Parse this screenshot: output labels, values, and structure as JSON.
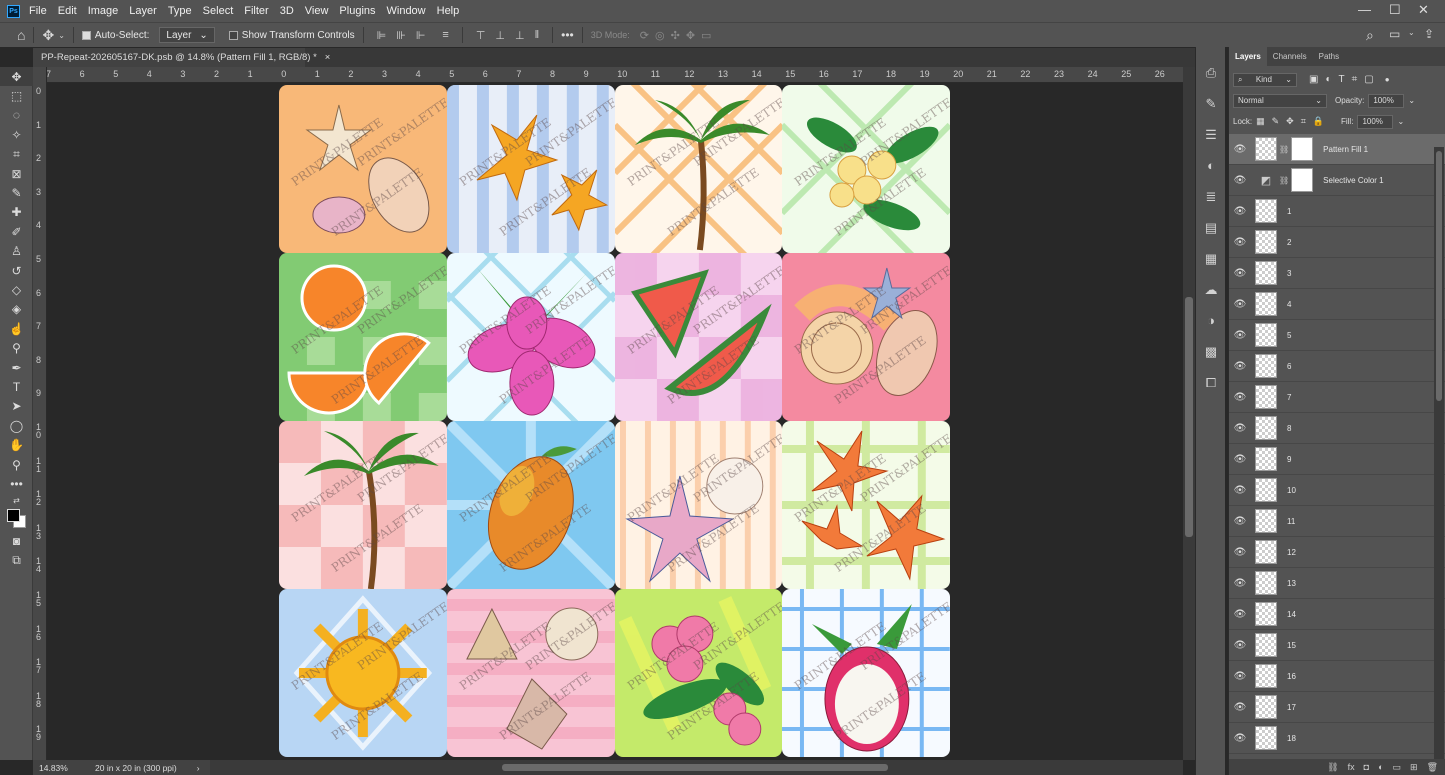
{
  "app": {
    "logo": "Ps"
  },
  "menu": [
    "File",
    "Edit",
    "Image",
    "Layer",
    "Type",
    "Select",
    "Filter",
    "3D",
    "View",
    "Plugins",
    "Window",
    "Help"
  ],
  "window_controls": {
    "minimize": "—",
    "maximize": "☐",
    "close": "✕"
  },
  "options": {
    "auto_select_label": "Auto-Select:",
    "auto_select_target": "Layer",
    "transform_label": "Show Transform Controls",
    "mode_3d": "3D Mode:",
    "more": "•••"
  },
  "document": {
    "tab_title": "PP-Repeat-202605167-DK.psb @ 14.8% (Pattern Fill 1, RGB/8) *",
    "close": "×"
  },
  "ruler_h": [
    "7",
    "6",
    "5",
    "4",
    "3",
    "2",
    "1",
    "0",
    "1",
    "2",
    "3",
    "4",
    "5",
    "6",
    "7",
    "8",
    "9",
    "10",
    "11",
    "12",
    "13",
    "14",
    "15",
    "16",
    "17",
    "18",
    "19",
    "20",
    "21",
    "22",
    "23",
    "24",
    "25",
    "26"
  ],
  "ruler_v": [
    "0",
    "1",
    "2",
    "3",
    "4",
    "5",
    "6",
    "7",
    "8",
    "9",
    "1\n0",
    "1\n1",
    "1\n2",
    "1\n3",
    "1\n4",
    "1\n5",
    "1\n6",
    "1\n7",
    "1\n8",
    "1\n9"
  ],
  "watermark": "PRINT&PALETTE",
  "tiles": [
    {
      "name": "seashells-peach",
      "bg": "#f8b878"
    },
    {
      "name": "orchid-blue-stripes",
      "bg": "#e8eef8"
    },
    {
      "name": "palm-orange-plaid",
      "bg": "#fff6ea"
    },
    {
      "name": "plumeria-green-plaid",
      "bg": "#f0fbea"
    },
    {
      "name": "orange-slices-green-gingham",
      "bg": "#a8dc98"
    },
    {
      "name": "hibiscus-blue-plaid",
      "bg": "#eefaff"
    },
    {
      "name": "watermelon-pink-check",
      "bg": "#f6d4ee"
    },
    {
      "name": "seashells-pink",
      "bg": "#f48aa0"
    },
    {
      "name": "palm-pink-check",
      "bg": "#fbe0e0"
    },
    {
      "name": "mango-blue-burst",
      "bg": "#7fc8f0"
    },
    {
      "name": "starfish-shells-peach-stripes",
      "bg": "#fff2e4"
    },
    {
      "name": "orchid-green-plaid",
      "bg": "#f4fbe8"
    },
    {
      "name": "sun-blue",
      "bg": "#b8d6f4"
    },
    {
      "name": "shells-pink-stripes",
      "bg": "#f8c4d4"
    },
    {
      "name": "plumeria-lime",
      "bg": "#c4ea6a"
    },
    {
      "name": "dragonfruit-blue-plaid",
      "bg": "#f6faff"
    }
  ],
  "status": {
    "zoom": "14.83%",
    "doc_info": "20 in x 20 in (300 ppi)",
    "arrow": "›"
  },
  "layers_panel": {
    "tabs": [
      "Layers",
      "Channels",
      "Paths"
    ],
    "filter_kind": "Kind",
    "blend_mode": "Normal",
    "opacity_label": "Opacity:",
    "opacity_value": "100%",
    "lock_label": "Lock:",
    "fill_label": "Fill:",
    "fill_value": "100%",
    "layers": [
      {
        "name": "Pattern Fill 1",
        "type": "fill",
        "selected": true
      },
      {
        "name": "Selective Color 1",
        "type": "adjustment",
        "selected": false
      },
      {
        "name": "1"
      },
      {
        "name": "2"
      },
      {
        "name": "3"
      },
      {
        "name": "4"
      },
      {
        "name": "5"
      },
      {
        "name": "6"
      },
      {
        "name": "7"
      },
      {
        "name": "8"
      },
      {
        "name": "9"
      },
      {
        "name": "10"
      },
      {
        "name": "11"
      },
      {
        "name": "12"
      },
      {
        "name": "13"
      },
      {
        "name": "14"
      },
      {
        "name": "15"
      },
      {
        "name": "16"
      },
      {
        "name": "17"
      },
      {
        "name": "18"
      }
    ]
  }
}
